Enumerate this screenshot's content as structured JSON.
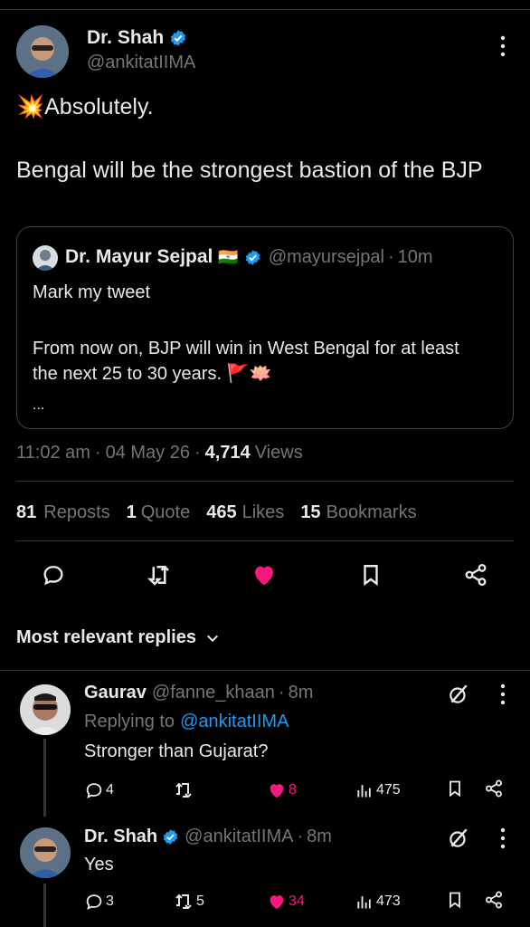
{
  "tweet": {
    "author_name": "Dr. Shah",
    "author_handle": "@ankitatIIMA",
    "line1": "💥Absolutely.",
    "line2": "Bengal will be the strongest bastion of the BJP",
    "time": "11:02 am",
    "date": "04 May 26",
    "views_count": "4,714",
    "views_label": "Views"
  },
  "quote": {
    "author_name": "Dr. Mayur Sejpal",
    "flag": "🇮🇳",
    "handle": "@mayursejpal",
    "age": "10m",
    "line1": "Mark my tweet",
    "line2": "From now on, BJP will win in West Bengal for at least the next 25 to 30 years. 🚩🪷",
    "ellipsis": "..."
  },
  "stats": {
    "reposts_count": "81",
    "reposts_label": "Reposts",
    "quotes_count": "1",
    "quotes_label": "Quote",
    "likes_count": "465",
    "likes_label": "Likes",
    "bookmarks_count": "15",
    "bookmarks_label": "Bookmarks"
  },
  "replies_header": "Most relevant replies",
  "replies": [
    {
      "name": "Gaurav",
      "handle": "@fanne_khaan",
      "age": "8m",
      "replying_prefix": "Replying to",
      "replying_to": "@ankitatIIMA",
      "text": "Stronger than Gujarat?",
      "replies": "4",
      "reposts": "",
      "likes": "8",
      "views": "475"
    },
    {
      "name": "Dr. Shah",
      "handle": "@ankitatIIMA",
      "age": "8m",
      "text": "Yes",
      "replies": "3",
      "reposts": "5",
      "likes": "34",
      "views": "473"
    }
  ],
  "colors": {
    "like": "#f91880",
    "link": "#1d9bf0",
    "verified": "#1d9bf0"
  }
}
